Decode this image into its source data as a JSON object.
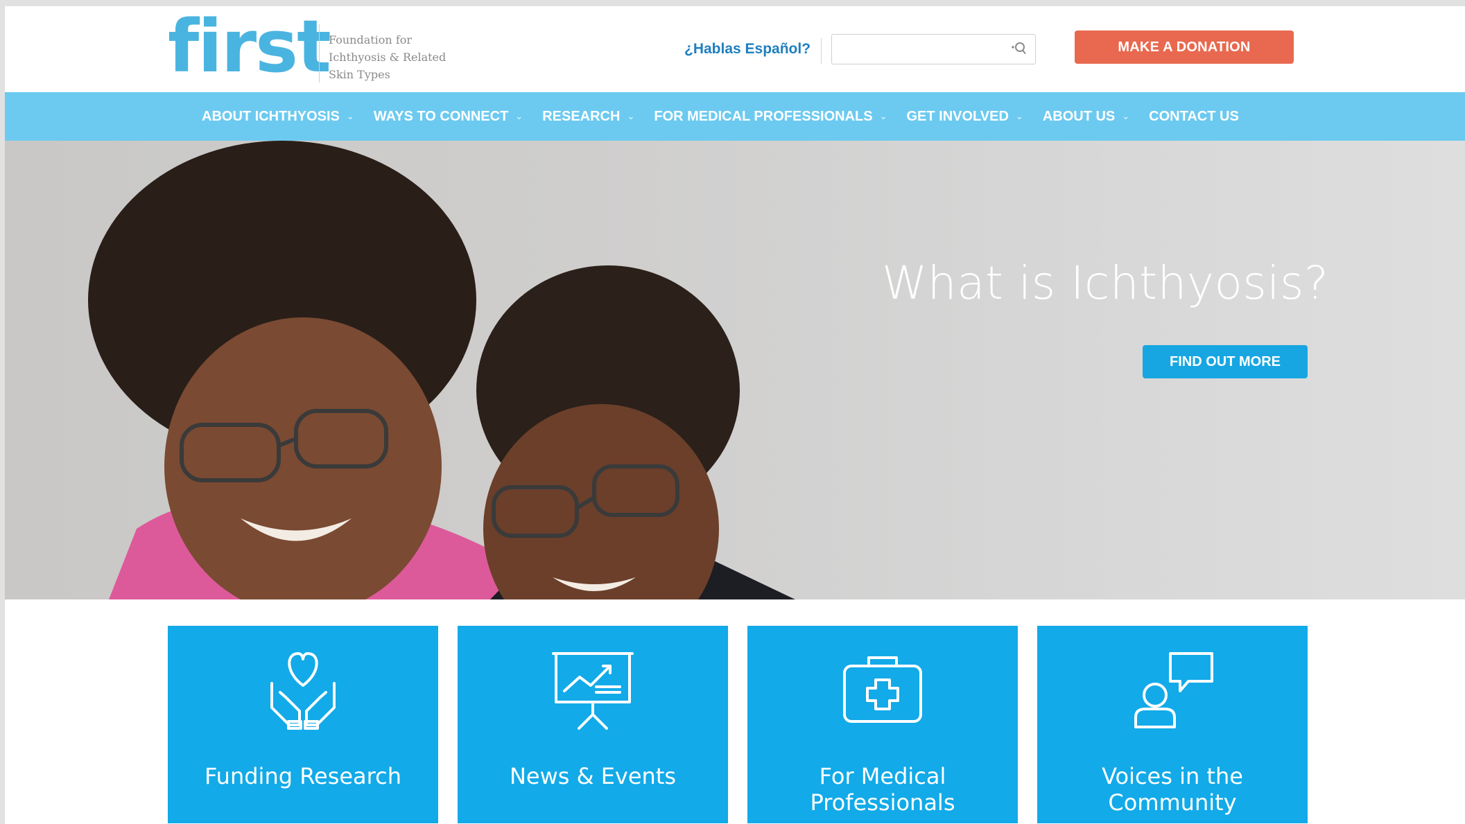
{
  "header": {
    "logo_text": "first",
    "tagline_lines": [
      "Foundation for",
      "Ichthyosis & Related",
      "Skin Types"
    ],
    "espanol_link": "¿Hablas Español?",
    "search": {
      "placeholder": "",
      "value": ""
    },
    "donate_label": "MAKE A DONATION"
  },
  "nav": {
    "items": [
      {
        "label": "ABOUT ICHTHYOSIS",
        "dropdown": true
      },
      {
        "label": "WAYS TO CONNECT",
        "dropdown": true
      },
      {
        "label": "RESEARCH",
        "dropdown": true
      },
      {
        "label": "FOR MEDICAL PROFESSIONALS",
        "dropdown": true
      },
      {
        "label": "GET INVOLVED",
        "dropdown": true
      },
      {
        "label": "ABOUT US",
        "dropdown": true
      },
      {
        "label": "CONTACT US",
        "dropdown": false
      }
    ]
  },
  "hero": {
    "title": "What is Ichthyosis?",
    "button_label": "FIND OUT MORE"
  },
  "tiles": [
    {
      "label": "Funding Research",
      "icon": "hands-heart-icon"
    },
    {
      "label": "News & Events",
      "icon": "presentation-chart-icon"
    },
    {
      "label": "For Medical Professionals",
      "icon": "medical-kit-icon"
    },
    {
      "label": "Voices in the Community",
      "icon": "person-speech-bubble-icon"
    }
  ],
  "colors": {
    "brand_blue": "#4ab4e0",
    "nav_blue": "#6ccaf0",
    "tile_blue": "#12aae8",
    "donate_orange": "#e8694f",
    "cta_blue": "#17a6e2"
  }
}
